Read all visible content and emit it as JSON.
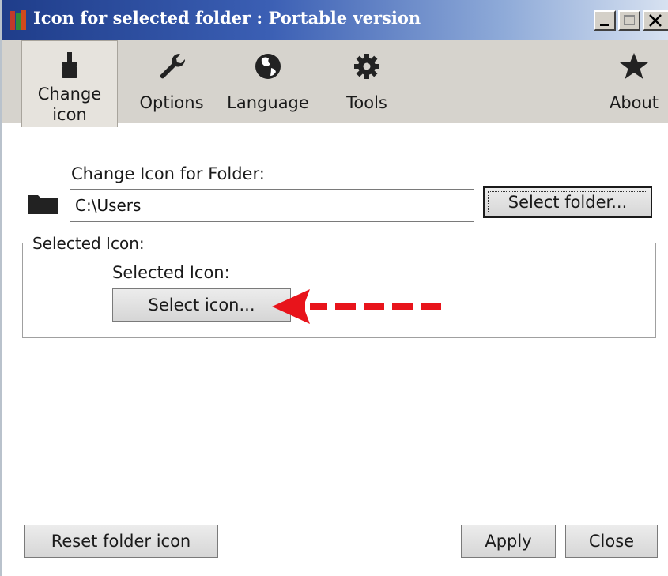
{
  "window": {
    "title": "Icon for selected folder : Portable version",
    "controls": {
      "minimize_glyph": "_",
      "maximize_glyph": "□",
      "close_glyph": "X"
    }
  },
  "toolbar": {
    "items": [
      {
        "label": "Change icon",
        "icon": "brush-icon",
        "active": true
      },
      {
        "label": "Options",
        "icon": "wrench-icon"
      },
      {
        "label": "Language",
        "icon": "globe-icon"
      },
      {
        "label": "Tools",
        "icon": "gear-icon"
      },
      {
        "label": "About",
        "icon": "star-icon"
      }
    ]
  },
  "folder_section": {
    "label": "Change Icon for Folder:",
    "path_value": "C:\\Users",
    "select_button": "Select folder..."
  },
  "icon_group": {
    "title": "Selected Icon:",
    "label": "Selected Icon:",
    "select_button": "Select icon..."
  },
  "footer": {
    "reset_button": "Reset folder icon",
    "apply_button": "Apply",
    "close_button": "Close"
  },
  "colors": {
    "annotation_arrow": "#e8141b",
    "title_bar_start": "#1f3d8a",
    "toolbar_bg": "#d6d3cd"
  }
}
